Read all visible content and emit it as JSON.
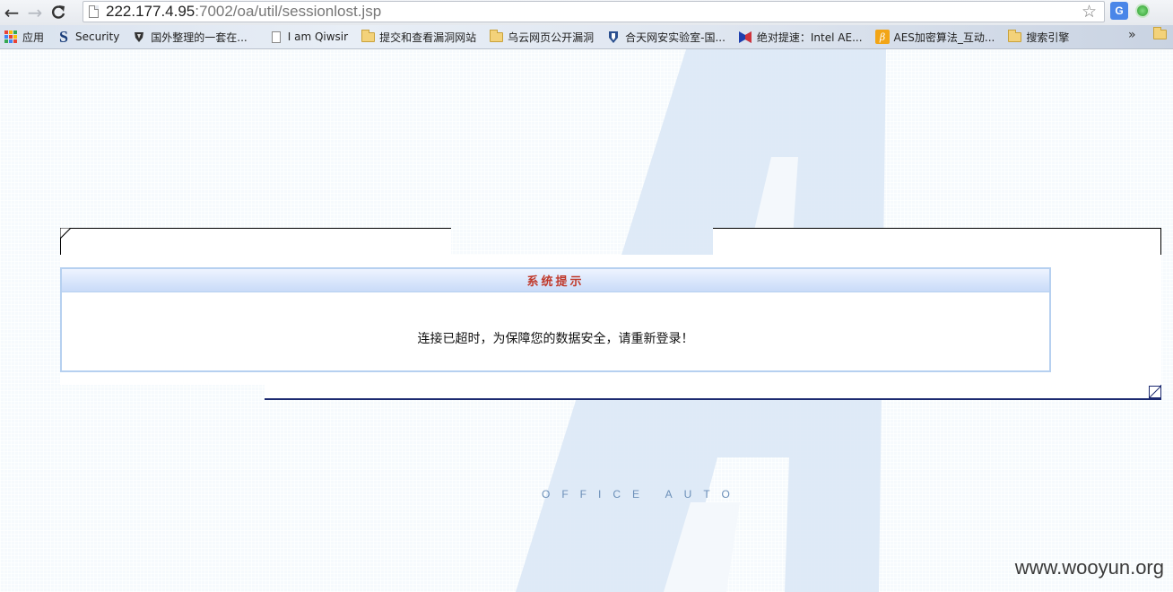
{
  "browser": {
    "url_host": "222.177.4.95",
    "url_path": ":7002/oa/util/sessionlost.jsp",
    "nav": {
      "back_icon": "←",
      "forward_icon": "→",
      "reload_icon": "C"
    },
    "star_icon": "☆",
    "translate_icon": "G",
    "more_icon": "»"
  },
  "bookmarks": {
    "items": [
      {
        "label": "应用",
        "icon": "apps-grid-icon"
      },
      {
        "label": "Security",
        "icon": "s-logo-icon"
      },
      {
        "label": "国外整理的一套在...",
        "icon": "shield-icon"
      },
      {
        "label": "I am Qiwsir",
        "icon": "document-icon"
      },
      {
        "label": "提交和查看漏洞网站",
        "icon": "folder-icon"
      },
      {
        "label": "乌云网页公开漏洞",
        "icon": "folder-icon"
      },
      {
        "label": "合天网安实验室-国...",
        "icon": "shield-badge-icon"
      },
      {
        "label": "绝对提速：Intel AE...",
        "icon": "bookmark-ribbon-icon"
      },
      {
        "label": "AES加密算法_互动...",
        "icon": "baike-icon"
      },
      {
        "label": "搜索引擎",
        "icon": "folder-icon"
      }
    ],
    "overflow": "»"
  },
  "dialog": {
    "title": "系统提示",
    "message": "连接已超时，为保障您的数据安全，请重新登录！"
  },
  "page": {
    "office_auto": "OFFICE AUTO",
    "watermark": "www.wooyun.org"
  }
}
